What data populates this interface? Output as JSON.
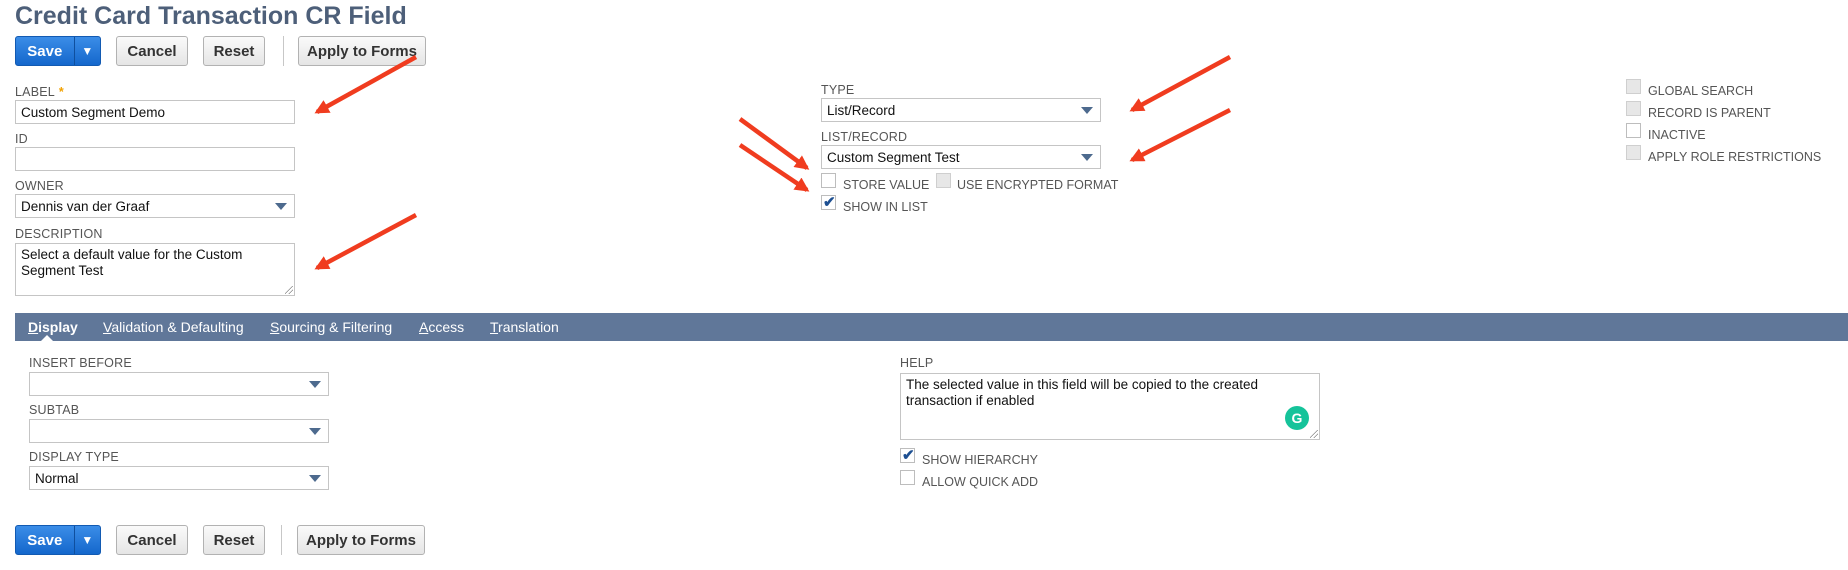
{
  "page": {
    "title": "Credit Card Transaction CR Field"
  },
  "toolbar": {
    "save_label": "Save",
    "save_dropdown_glyph": "▼",
    "cancel_label": "Cancel",
    "reset_label": "Reset",
    "apply_label": "Apply to Forms"
  },
  "form": {
    "label": {
      "caption": "LABEL",
      "required_mark": "*",
      "value": "Custom Segment Demo"
    },
    "id": {
      "caption": "ID",
      "value": ""
    },
    "owner": {
      "caption": "OWNER",
      "value": "Dennis van der Graaf"
    },
    "description": {
      "caption": "DESCRIPTION",
      "value": "Select a default value for the Custom Segment Test"
    },
    "type": {
      "caption": "TYPE",
      "value": "List/Record"
    },
    "list_record": {
      "caption": "LIST/RECORD",
      "value": "Custom Segment Test"
    },
    "store_value": {
      "caption": "STORE VALUE",
      "checked": false
    },
    "use_encrypted": {
      "caption": "USE ENCRYPTED FORMAT",
      "checked": false
    },
    "show_in_list": {
      "caption": "SHOW IN LIST",
      "checked": true
    },
    "global_search": {
      "caption": "GLOBAL SEARCH",
      "checked": false
    },
    "record_is_parent": {
      "caption": "RECORD IS PARENT",
      "checked": false
    },
    "inactive": {
      "caption": "INACTIVE",
      "checked": false
    },
    "apply_role": {
      "caption": "APPLY ROLE RESTRICTIONS",
      "checked": false
    }
  },
  "tabs": [
    {
      "key": "D",
      "rest": "isplay",
      "active": true
    },
    {
      "key": "V",
      "rest": "alidation & Defaulting",
      "active": false
    },
    {
      "key": "S",
      "rest": "ourcing & Filtering",
      "active": false
    },
    {
      "key": "A",
      "rest": "ccess",
      "active": false
    },
    {
      "key": "T",
      "rest": "ranslation",
      "active": false
    }
  ],
  "display": {
    "insert_before": {
      "caption": "INSERT BEFORE",
      "value": ""
    },
    "subtab": {
      "caption": "SUBTAB",
      "value": ""
    },
    "display_type": {
      "caption": "DISPLAY TYPE",
      "value": "Normal"
    },
    "help": {
      "caption": "HELP",
      "value": "The selected value in this field will be copied to the created transaction if enabled"
    },
    "show_hierarchy": {
      "caption": "SHOW HIERARCHY",
      "checked": true
    },
    "allow_quick_add": {
      "caption": "ALLOW QUICK ADD",
      "checked": false
    }
  },
  "icons": {
    "grammarly": "grammarly-icon",
    "annotation_arrow": "red-arrow"
  },
  "colors": {
    "title": "#4d5f79",
    "save_button": "#1467cc",
    "tab_bar": "#607799",
    "annotation": "#f03c1f",
    "checkmark": "#1d4f91"
  }
}
